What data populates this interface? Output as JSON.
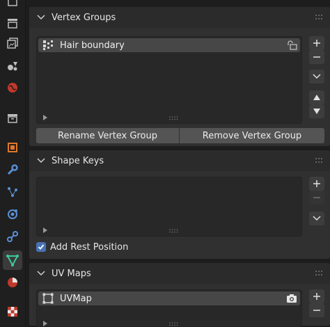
{
  "tabs": [
    {
      "icon": "tool-icon"
    },
    {
      "icon": "render-icon"
    },
    {
      "icon": "output-icon"
    },
    {
      "icon": "view-layer-icon"
    },
    {
      "icon": "scene-icon"
    },
    {
      "icon": "world-icon"
    },
    {
      "icon": "collection-icon"
    },
    {
      "icon": "object-icon"
    },
    {
      "icon": "modifier-icon"
    },
    {
      "icon": "particles-icon"
    },
    {
      "icon": "physics-icon"
    },
    {
      "icon": "constraints-icon"
    },
    {
      "icon": "object-data-icon",
      "active": true
    },
    {
      "icon": "material-icon"
    },
    {
      "icon": "texture-icon"
    }
  ],
  "vertex_groups": {
    "title": "Vertex Groups",
    "items": [
      {
        "label": "Hair boundary"
      }
    ],
    "rename_button": "Rename Vertex Group",
    "remove_button": "Remove Vertex Group"
  },
  "shape_keys": {
    "title": "Shape Keys",
    "add_rest_position_label": "Add Rest Position",
    "add_rest_position_checked": true
  },
  "uv_maps": {
    "title": "UV Maps",
    "items": [
      {
        "label": "UVMap"
      }
    ]
  },
  "colors": {
    "accent": "#4772b3",
    "panel": "#303030",
    "header": "#2b2b2b",
    "list_bg": "#282828",
    "row_selected": "#474747"
  }
}
